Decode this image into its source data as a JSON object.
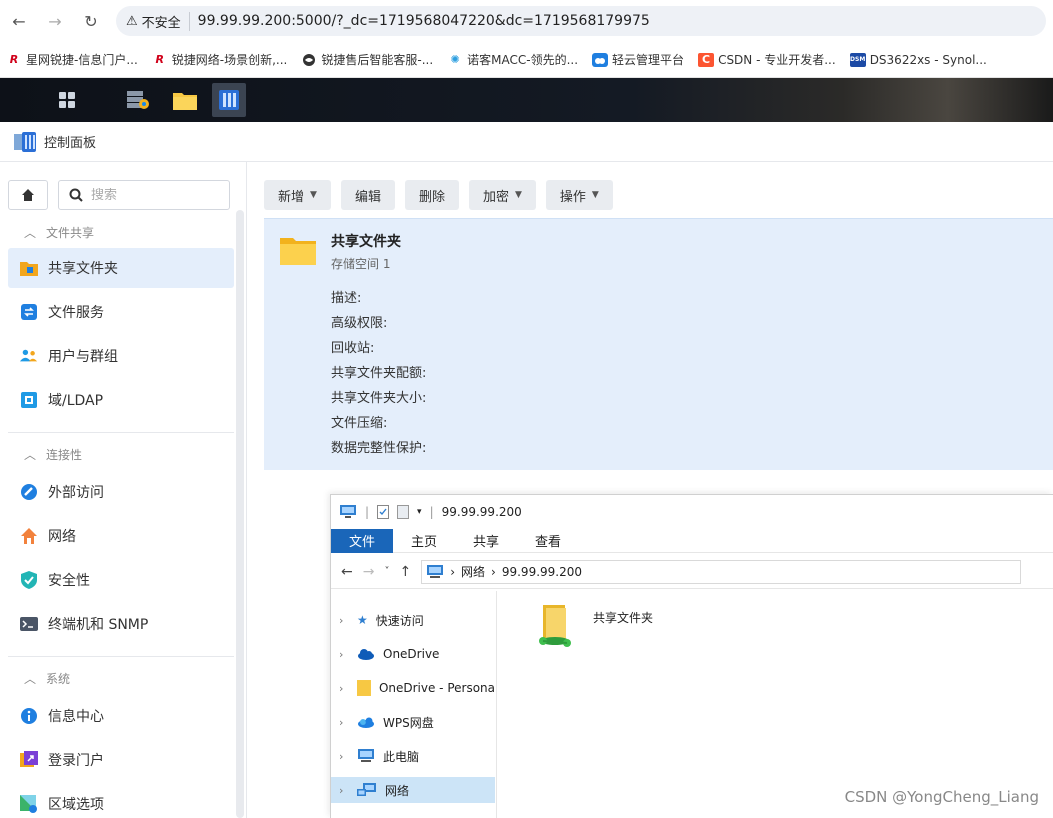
{
  "browser": {
    "insecure_label": "不安全",
    "url": "99.99.99.200:5000/?_dc=1719568047220&dc=1719568179975",
    "bookmarks": [
      "星网锐捷-信息门户...",
      "锐捷网络-场景创新,...",
      "锐捷售后智能客服-...",
      "诺客MACC-领先的...",
      "轻云管理平台",
      "CSDN - 专业开发者...",
      "DS3622xs - Synol..."
    ]
  },
  "control_panel": {
    "title": "控制面板"
  },
  "sidebar": {
    "search_placeholder": "搜索",
    "sections": {
      "file_sharing": "文件共享",
      "connectivity": "连接性",
      "system": "系统"
    },
    "items": {
      "shared_folder": "共享文件夹",
      "file_services": "文件服务",
      "users_groups": "用户与群组",
      "domain_ldap": "域/LDAP",
      "external_access": "外部访问",
      "network": "网络",
      "security": "安全性",
      "terminal_snmp": "终端机和 SNMP",
      "info_center": "信息中心",
      "login_portal": "登录门户",
      "regional_options": "区域选项"
    }
  },
  "toolbar": {
    "create": "新增",
    "edit": "编辑",
    "delete": "删除",
    "encrypt": "加密",
    "action": "操作"
  },
  "share": {
    "name": "共享文件夹",
    "volume": "存储空间 1",
    "props": {
      "description": "描述:",
      "advanced_permissions": "高级权限:",
      "recycle_bin": "回收站:",
      "quota": "共享文件夹配额:",
      "size": "共享文件夹大小:",
      "compression": "文件压缩:",
      "integrity": "数据完整性保护:"
    }
  },
  "explorer": {
    "title": "99.99.99.200",
    "tabs": {
      "file": "文件",
      "home": "主页",
      "share": "共享",
      "view": "查看"
    },
    "path": {
      "network": "网络",
      "host": "99.99.99.200"
    },
    "tree": {
      "quick_access": "快速访问",
      "onedrive": "OneDrive",
      "onedrive_personal": "OneDrive - Persona",
      "wps": "WPS网盘",
      "this_pc": "此电脑",
      "network": "网络"
    },
    "content_item": "共享文件夹"
  },
  "watermark": "CSDN @YongCheng_Liang",
  "colors": {
    "accent": "#1a66b9",
    "selected_bg": "#e4eefb",
    "folder": "#f7c843"
  }
}
